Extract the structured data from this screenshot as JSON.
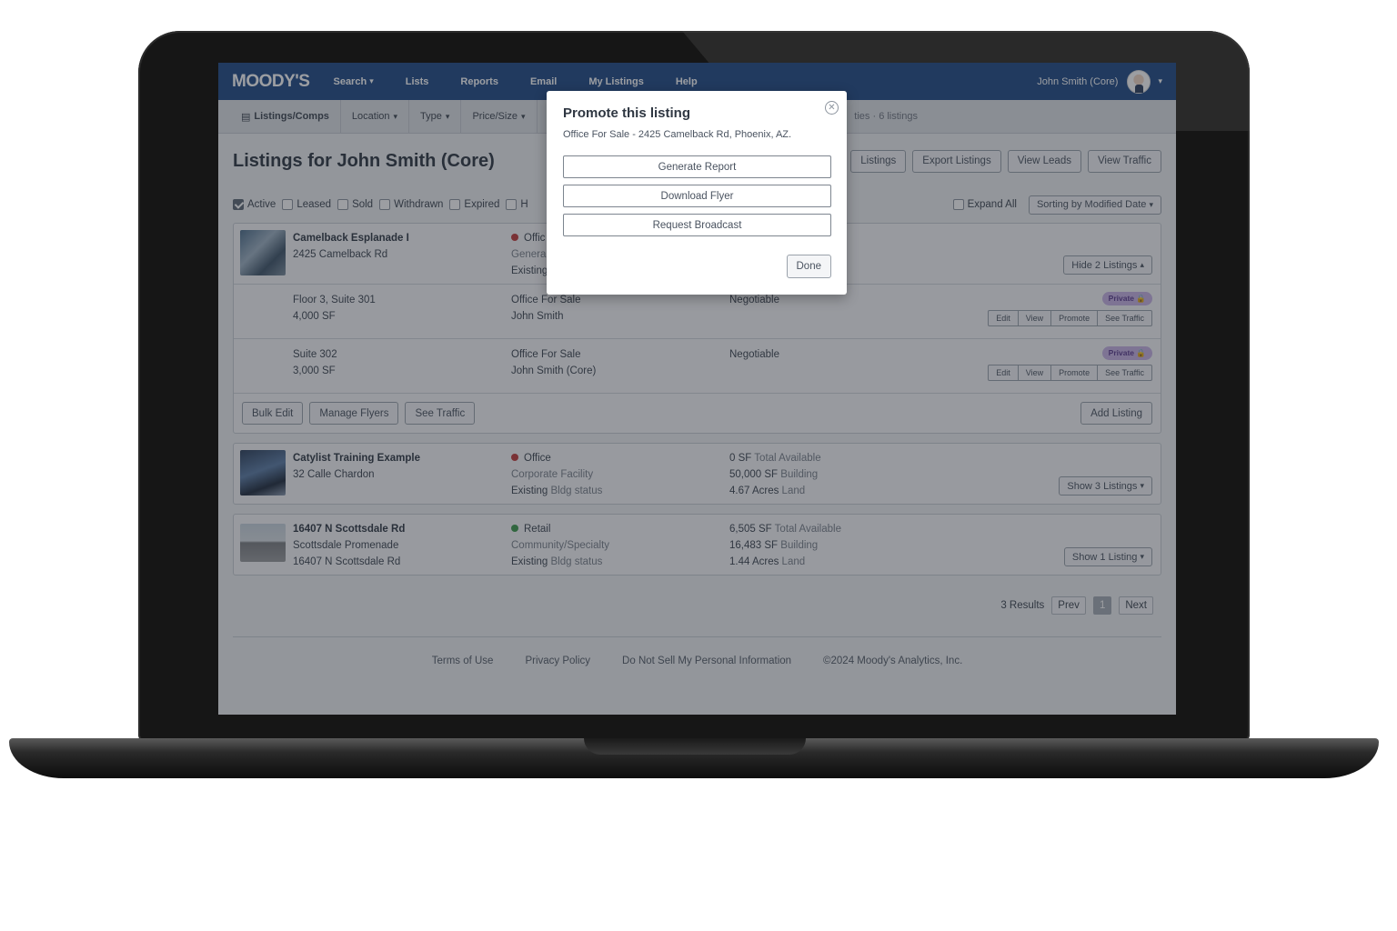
{
  "nav": {
    "logo": "MOODY'S",
    "items": [
      "Search",
      "Lists",
      "Reports",
      "Email",
      "My Listings",
      "Help"
    ],
    "user": "John Smith (Core)"
  },
  "subnav": {
    "items": [
      "Listings/Comps",
      "Location",
      "Type",
      "Price/Size"
    ],
    "summary": "ties · 6 listings"
  },
  "page": {
    "title": "Listings for John Smith (Core)",
    "actions": [
      "Listings",
      "Export Listings",
      "View Leads",
      "View Traffic"
    ]
  },
  "filters": {
    "items": [
      {
        "label": "Active",
        "checked": true
      },
      {
        "label": "Leased",
        "checked": false
      },
      {
        "label": "Sold",
        "checked": false
      },
      {
        "label": "Withdrawn",
        "checked": false
      },
      {
        "label": "Expired",
        "checked": false
      },
      {
        "label": "H",
        "checked": false
      }
    ],
    "expand_all": "Expand All",
    "sort": "Sorting by Modified Date"
  },
  "properties": [
    {
      "name": "Camelback Esplanade I",
      "address": "2425 Camelback Rd",
      "type": "Offic",
      "subtype": "Genera",
      "status": "Existing",
      "toggle": "Hide 2 Listings",
      "listings": [
        {
          "unit": "Floor 3, Suite 301",
          "size": "4,000 SF",
          "kind": "Office For Sale",
          "agent": "John Smith",
          "price": "Negotiable",
          "badge": "Private"
        },
        {
          "unit": "Suite 302",
          "size": "3,000 SF",
          "kind": "Office For Sale",
          "agent": "John Smith (Core)",
          "price": "Negotiable",
          "badge": "Private"
        }
      ],
      "row_actions": [
        "Edit",
        "View",
        "Promote",
        "See Traffic"
      ],
      "card_actions": [
        "Bulk Edit",
        "Manage Flyers",
        "See Traffic"
      ],
      "add_listing": "Add Listing"
    },
    {
      "name": "Catylist Training Example",
      "address": "32 Calle Chardon",
      "type": "Office",
      "subtype": "Corporate Facility",
      "status_value": "Existing",
      "status_label": "Bldg status",
      "avail_value": "0 SF",
      "avail_label": "Total Available",
      "bldg_value": "50,000 SF",
      "bldg_label": "Building",
      "land_value": "4.67 Acres",
      "land_label": "Land",
      "toggle": "Show 3 Listings"
    },
    {
      "name": "16407 N Scottsdale Rd",
      "address2": "Scottsdale Promenade",
      "address": "16407 N Scottsdale Rd",
      "type": "Retail",
      "subtype": "Community/Specialty",
      "status_value": "Existing",
      "status_label": "Bldg status",
      "avail_value": "6,505 SF",
      "avail_label": "Total Available",
      "bldg_value": "16,483 SF",
      "bldg_label": "Building",
      "land_value": "1.44 Acres",
      "land_label": "Land",
      "toggle": "Show 1 Listing"
    }
  ],
  "pager": {
    "results": "3 Results",
    "prev": "Prev",
    "page": "1",
    "next": "Next"
  },
  "footer": [
    "Terms of Use",
    "Privacy Policy",
    "Do Not Sell My Personal Information",
    "©2024 Moody's Analytics, Inc."
  ],
  "modal": {
    "title": "Promote this listing",
    "subtitle": "Office For Sale - 2425 Camelback Rd, Phoenix, AZ.",
    "buttons": [
      "Generate Report",
      "Download Flyer",
      "Request Broadcast"
    ],
    "done": "Done"
  },
  "icons": {
    "close": "close-icon",
    "caret": "chevron-down-icon",
    "lock": "lock-icon",
    "avatar": "avatar"
  },
  "colors": {
    "nav": "#1f4a86",
    "private_badge": "#c8b3e6",
    "status_red": "#c23b3b",
    "status_green": "#3c9a4b"
  }
}
